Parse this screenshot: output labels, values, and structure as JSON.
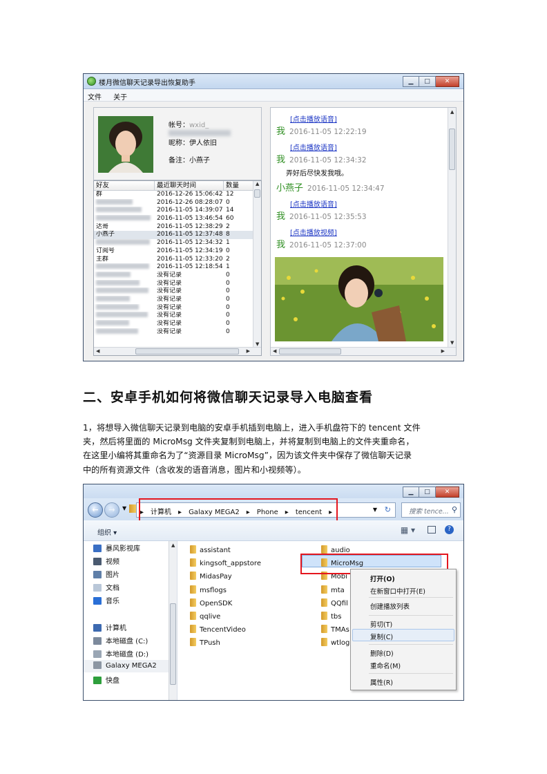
{
  "window1": {
    "title": "楼月微信聊天记录导出恢复助手",
    "menu": [
      "文件",
      "关于"
    ],
    "profile": {
      "account_label": "帐号：",
      "account_value": "wxid_",
      "nickname_label": "昵称：",
      "nickname_value": "伊人依旧",
      "remark_label": "备注：",
      "remark_value": "小燕子"
    },
    "table": {
      "headers": [
        "好友",
        "最近聊天时间",
        "数量"
      ],
      "rows": [
        [
          "群",
          "2016-12-26 15:06:42",
          "12"
        ],
        [
          "",
          "2016-12-26 08:28:07",
          "0"
        ],
        [
          "",
          "2016-11-05 14:39:07",
          "14"
        ],
        [
          "",
          "2016-11-05 13:46:54",
          "60"
        ],
        [
          "达哥",
          "2016-11-05 12:38:29",
          "2"
        ],
        [
          "小燕子",
          "2016-11-05 12:37:48",
          "8"
        ],
        [
          "",
          "2016-11-05 12:34:32",
          "1"
        ],
        [
          "订阅号",
          "2016-11-05 12:34:19",
          "0"
        ],
        [
          "主群",
          "2016-11-05 12:33:20",
          "2"
        ],
        [
          "",
          "2016-11-05 12:18:54",
          "1"
        ],
        [
          "",
          "没有记录",
          "0"
        ],
        [
          "",
          "没有记录",
          "0"
        ],
        [
          "",
          "没有记录",
          "0"
        ],
        [
          "",
          "没有记录",
          "0"
        ],
        [
          "",
          "没有记录",
          "0"
        ],
        [
          "",
          "没有记录",
          "0"
        ],
        [
          "",
          "没有记录",
          "0"
        ],
        [
          "",
          "没有记录",
          "0"
        ]
      ],
      "selected_row": 5
    },
    "chat": [
      {
        "type": "link",
        "text": "[点击播放语音]"
      },
      {
        "type": "head",
        "sender": "我",
        "time": "2016-11-05 12:22:19"
      },
      {
        "type": "link",
        "text": "[点击播放语音]"
      },
      {
        "type": "head",
        "sender": "我",
        "time": "2016-11-05 12:34:32"
      },
      {
        "type": "msg",
        "text": "弄好后尽快发我哦。"
      },
      {
        "type": "head",
        "sender": "小燕子",
        "time": "2016-11-05 12:34:47"
      },
      {
        "type": "link",
        "text": "[点击播放语音]"
      },
      {
        "type": "head",
        "sender": "我",
        "time": "2016-11-05 12:35:53"
      },
      {
        "type": "link",
        "text": "[点击播放视频]"
      },
      {
        "type": "head",
        "sender": "我",
        "time": "2016-11-05 12:37:00"
      }
    ]
  },
  "section": {
    "heading": "二、安卓手机如何将微信聊天记录导入电脑查看",
    "paragraph_lines": [
      "1，将想导入微信聊天记录到电脑的安卓手机插到电脑上，进入手机盘符下的 tencent 文件",
      "夹，然后将里面的 MicroMsg 文件夹复制到电脑上，并将复制到电脑上的文件夹重命名，",
      "在这里小编将其重命名为了“资源目录 MicroMsg”，因为该文件夹中保存了微信聊天记录",
      "中的所有资源文件（含收发的语音消息，图片和小视频等）。"
    ]
  },
  "window2": {
    "breadcrumb": [
      "计算机",
      "Galaxy MEGA2",
      "Phone",
      "tencent"
    ],
    "search_placeholder": "搜索 tence...",
    "organize": "组织 ▾",
    "nav": [
      {
        "label": "暴风影视库",
        "icon": "library-icon",
        "color": "#3a6fc4"
      },
      {
        "label": "视频",
        "icon": "video-icon",
        "color": "#4a5a70"
      },
      {
        "label": "图片",
        "icon": "picture-icon",
        "color": "#5f7fa8"
      },
      {
        "label": "文档",
        "icon": "document-icon",
        "color": "#b9c7d8"
      },
      {
        "label": "音乐",
        "icon": "music-icon",
        "color": "#2a6fd6"
      },
      {
        "label": "计算机",
        "icon": "computer-icon",
        "color": "#3d6ab0"
      },
      {
        "label": "本地磁盘 (C:)",
        "icon": "disk-c-icon",
        "color": "#7c8a9c"
      },
      {
        "label": "本地磁盘 (D:)",
        "icon": "disk-d-icon",
        "color": "#9aa6b4"
      },
      {
        "label": "Galaxy MEGA2",
        "icon": "phone-icon",
        "color": "#8c96a3"
      },
      {
        "label": "快盘",
        "icon": "kuaipan-icon",
        "color": "#2e9f3c"
      }
    ],
    "files_col1": [
      "assistant",
      "kingsoft_appstore",
      "MidasPay",
      "msflogs",
      "OpenSDK",
      "qqlive",
      "TencentVideo",
      "TPush"
    ],
    "files_col2": [
      "audio",
      "MicroMsg",
      "Mobi",
      "mta",
      "QQfil",
      "tbs",
      "TMAs",
      "wtlog"
    ],
    "context_menu": [
      "打开(O)",
      "在新窗口中打开(E)",
      "创建播放列表",
      "剪切(T)",
      "复制(C)",
      "删除(D)",
      "重命名(M)",
      "属性(R)"
    ]
  }
}
